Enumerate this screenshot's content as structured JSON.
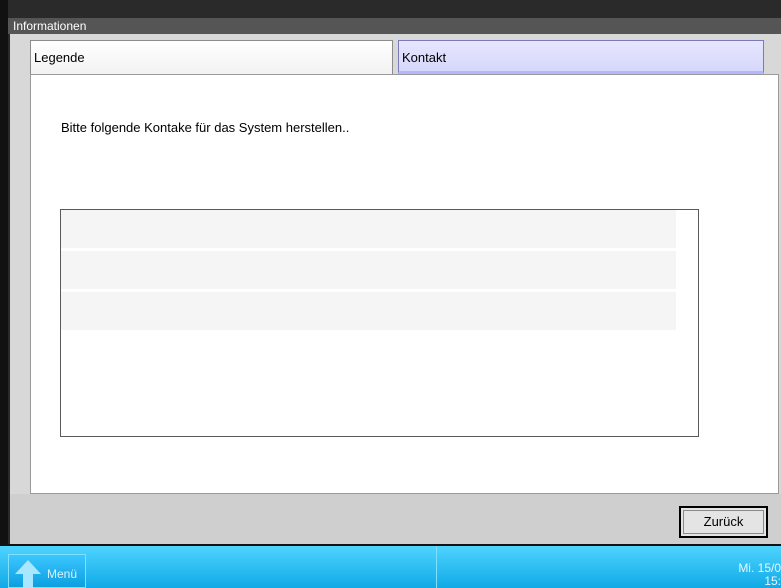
{
  "window": {
    "title": "Informationen"
  },
  "tabs": [
    {
      "label": "Legende",
      "selected": false
    },
    {
      "label": "Kontakt",
      "selected": true
    }
  ],
  "content": {
    "message": "Bitte folgende Kontake für das System herstellen..",
    "contact_rows": [
      "",
      "",
      ""
    ]
  },
  "footer": {
    "back_label": "Zurück"
  },
  "taskbar": {
    "menu_label": "Menü",
    "menu_icon": "arrow-up-icon",
    "clock_line1": "Mi. 15/0",
    "clock_line2": "15:"
  },
  "colors": {
    "taskbar": "#1ab4ee",
    "selected_tab": "#dcdcfc",
    "titlebar": "#555555"
  }
}
